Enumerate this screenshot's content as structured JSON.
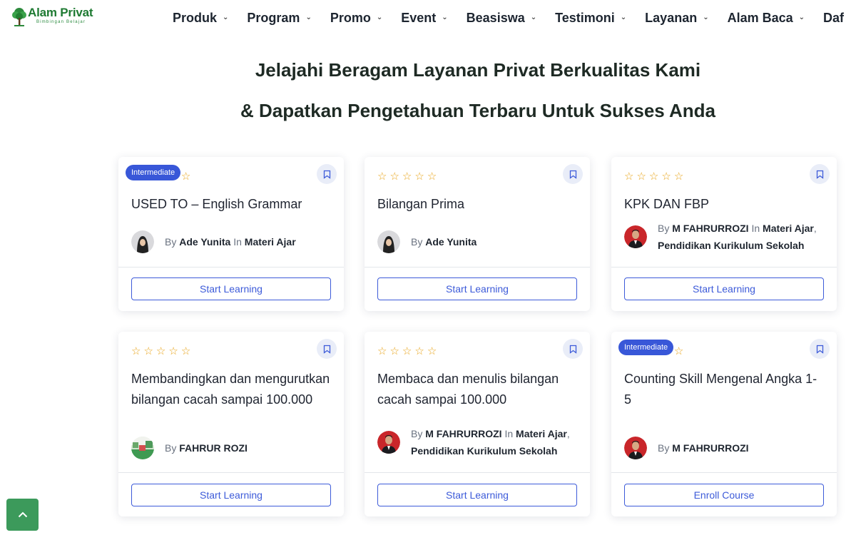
{
  "brand": {
    "title": "Alam Privat",
    "subtitle": "Bimbingan Belajar"
  },
  "nav": [
    {
      "label": "Produk"
    },
    {
      "label": "Program"
    },
    {
      "label": "Promo"
    },
    {
      "label": "Event"
    },
    {
      "label": "Beasiswa"
    },
    {
      "label": "Testimoni"
    },
    {
      "label": "Layanan"
    },
    {
      "label": "Alam Baca"
    },
    {
      "label": "Daf"
    }
  ],
  "headline": {
    "line1": "Jelajahi Beragam Layanan Privat Berkualitas Kami",
    "line2": "& Dapatkan Pengetahuan Terbaru Untuk Sukses Anda"
  },
  "colors": {
    "accent": "#3d5bd9",
    "star": "#e8a317",
    "brand_green": "#1e7a32",
    "badge": "#3857d8",
    "scroll_button": "#3c9a5b"
  },
  "courses": [
    {
      "title": "USED TO – English Grammar",
      "badge": "Intermediate",
      "rating": 0,
      "by": "By",
      "author": "Ade Yunita",
      "in": "In",
      "category": "Materi Ajar",
      "category2": "",
      "avatar": "female-hijab",
      "button": "Start Learning"
    },
    {
      "title": "Bilangan Prima",
      "badge": "",
      "rating": 0,
      "by": "By",
      "author": "Ade Yunita",
      "in": "",
      "category": "",
      "category2": "",
      "avatar": "female-hijab",
      "button": "Start Learning"
    },
    {
      "title": "KPK DAN FBP",
      "badge": "",
      "rating": 0,
      "by": "By",
      "author": "M FAHRURROZI",
      "in": "In",
      "category": "Materi Ajar",
      "category2": "Pendidikan Kurikulum Sekolah",
      "avatar": "male-red",
      "button": "Start Learning"
    },
    {
      "title": "Membandingkan dan mengurutkan bilangan cacah sampai 100.000",
      "badge": "",
      "rating": 0,
      "by": "By",
      "author": "FAHRUR ROZI",
      "in": "",
      "category": "",
      "category2": "",
      "avatar": "landscape",
      "button": "Start Learning"
    },
    {
      "title": "Membaca dan menulis bilangan cacah sampai 100.000",
      "badge": "",
      "rating": 0,
      "by": "By",
      "author": "M FAHRURROZI",
      "in": "In",
      "category": "Materi Ajar",
      "category2": "Pendidikan Kurikulum Sekolah",
      "avatar": "male-red",
      "button": "Start Learning"
    },
    {
      "title": "Counting Skill Mengenal Angka 1-5",
      "badge": "Intermediate",
      "rating": 0,
      "by": "By",
      "author": "M FAHRURROZI",
      "in": "",
      "category": "",
      "category2": "",
      "avatar": "male-red",
      "button": "Enroll Course"
    }
  ]
}
